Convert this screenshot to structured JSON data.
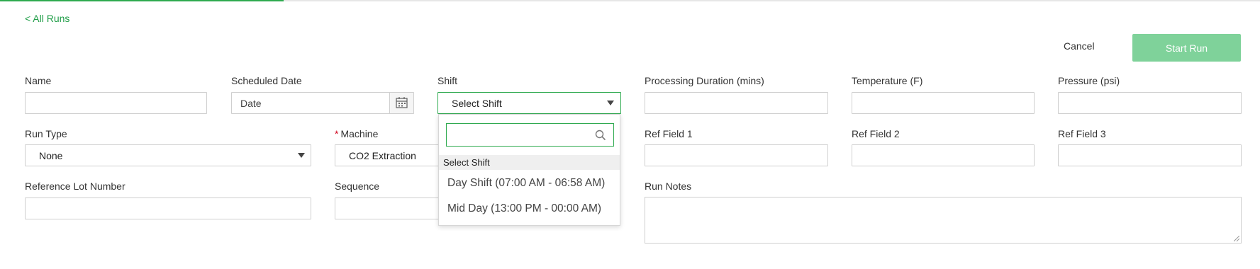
{
  "nav": {
    "back_label": "< All Runs",
    "progress": 0.225
  },
  "actions": {
    "cancel_label": "Cancel",
    "start_label": "Start Run",
    "start_color": "#7fd29a"
  },
  "form": {
    "name": {
      "label": "Name",
      "value": ""
    },
    "scheduled_date": {
      "label": "Scheduled Date",
      "placeholder": "Date"
    },
    "shift": {
      "label": "Shift",
      "selected": "Select Shift"
    },
    "processing_duration": {
      "label": "Processing Duration (mins)",
      "value": ""
    },
    "temperature": {
      "label": "Temperature (F)",
      "value": ""
    },
    "pressure": {
      "label": "Pressure (psi)",
      "value": ""
    },
    "run_type": {
      "label": "Run Type",
      "selected": "None"
    },
    "machine": {
      "label": "Machine",
      "required_mark": "*",
      "selected": "CO2 Extraction"
    },
    "ref_field_1": {
      "label": "Ref Field 1",
      "value": ""
    },
    "ref_field_2": {
      "label": "Ref Field 2",
      "value": ""
    },
    "ref_field_3": {
      "label": "Ref Field 3",
      "value": ""
    },
    "reference_lot": {
      "label": "Reference Lot Number",
      "value": ""
    },
    "sequence": {
      "label": "Sequence",
      "value": ""
    },
    "run_notes": {
      "label": "Run Notes",
      "value": ""
    }
  },
  "shift_dropdown": {
    "search_value": "",
    "group_header": "Select Shift",
    "options": [
      "Day Shift (07:00 AM - 06:58 AM)",
      "Mid Day (13:00 PM - 00:00 AM)"
    ]
  },
  "colors": {
    "accent": "#2eaa4f",
    "link": "#1f9d47",
    "required": "#d0021b"
  }
}
